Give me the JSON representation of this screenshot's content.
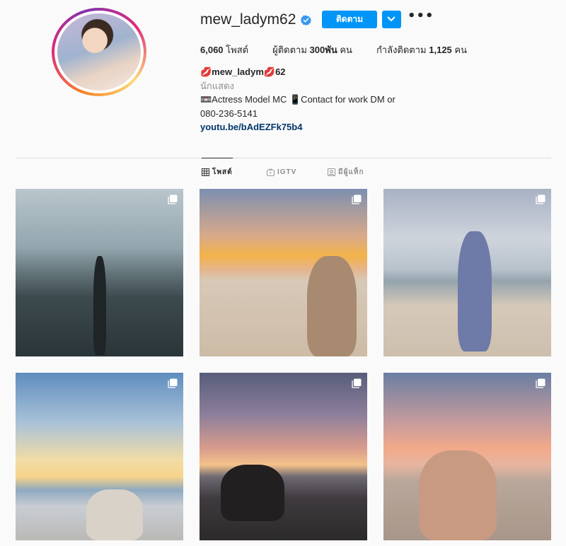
{
  "profile": {
    "username": "mew_ladym62",
    "follow_label": "ติดตาม",
    "more_label": "•••"
  },
  "stats": {
    "posts_count": "6,060",
    "posts_label": "โพสต์",
    "followers_label": "ผู้ติดตาม",
    "followers_count": "300พัน",
    "followers_unit": "คน",
    "following_label": "กำลังติดตาม",
    "following_count": "1,125",
    "following_unit": "คน"
  },
  "bio": {
    "name": "💋mew_ladym💋62",
    "category": "นักแสดง",
    "line1": "📼Actress Model MC 📱Contact for work DM or",
    "line2": "080-236-5141",
    "link": "youtu.be/bAdEZFk75b4"
  },
  "tabs": [
    {
      "label": "โพสต์",
      "icon": "grid-icon",
      "active": true
    },
    {
      "label": "IGTV",
      "icon": "igtv-icon",
      "active": false
    },
    {
      "label": "มีผู้แท็ก",
      "icon": "tagged-icon",
      "active": false
    }
  ],
  "posts": [
    {
      "type": "carousel",
      "icon": "multiple-posts-icon"
    },
    {
      "type": "carousel",
      "icon": "multiple-posts-icon"
    },
    {
      "type": "carousel",
      "icon": "multiple-posts-icon"
    },
    {
      "type": "carousel",
      "icon": "multiple-posts-icon"
    },
    {
      "type": "carousel",
      "icon": "multiple-posts-icon"
    },
    {
      "type": "carousel",
      "icon": "multiple-posts-icon"
    }
  ],
  "colors": {
    "accent": "#0095f6",
    "link": "#00376b",
    "muted": "#8e8e8e",
    "verified": "#3897f0"
  }
}
